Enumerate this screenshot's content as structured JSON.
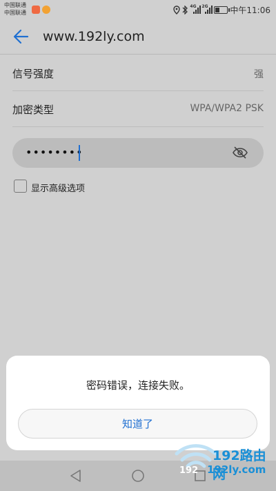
{
  "status_bar": {
    "carrier_1": "中国联通",
    "carrier_2": "中国联通",
    "net_type_1": "4G",
    "net_type_2": "2G",
    "time": "中午11:06",
    "battery_level": 0.35
  },
  "header": {
    "title": "www.192ly.com"
  },
  "rows": [
    {
      "label": "信号强度",
      "value": "强"
    },
    {
      "label": "加密类型",
      "value": "WPA/WPA2 PSK"
    }
  ],
  "password": {
    "masked_value": "••••••••"
  },
  "advanced": {
    "label": "显示高级选项",
    "checked": false
  },
  "dialog": {
    "message": "密码错误，连接失败。",
    "button_label": "知道了"
  },
  "watermark": {
    "brand": "192路由网",
    "url": "192ly.com",
    "mark": "192"
  },
  "colors": {
    "accent": "#1f6fd1",
    "dim_background": "#d0d0d0",
    "watermark": "#1a8fd6"
  }
}
